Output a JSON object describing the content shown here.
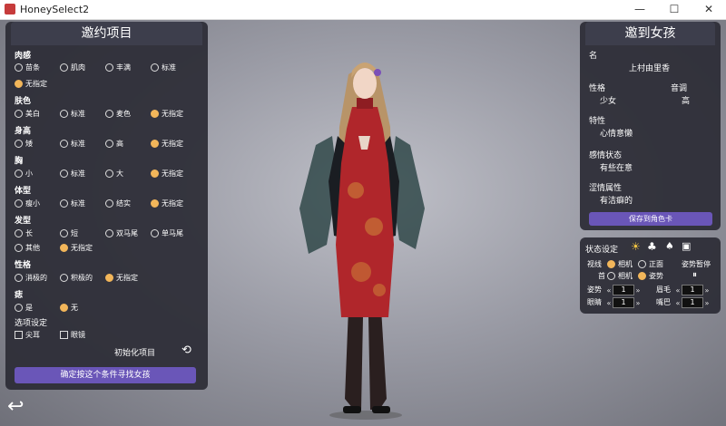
{
  "window": {
    "title": "HoneySelect2",
    "minimize": "—",
    "maximize": "☐",
    "close": "✕"
  },
  "left_panel": {
    "title": "邀约项目",
    "sections": [
      {
        "label": "肉感",
        "options": [
          {
            "label": "苗条",
            "selected": false
          },
          {
            "label": "肌肉",
            "selected": false
          },
          {
            "label": "丰满",
            "selected": false
          },
          {
            "label": "标准",
            "selected": false
          },
          {
            "label": "无指定",
            "selected": true
          }
        ]
      },
      {
        "label": "肤色",
        "options": [
          {
            "label": "美白",
            "selected": false
          },
          {
            "label": "标准",
            "selected": false
          },
          {
            "label": "麦色",
            "selected": false
          },
          {
            "label": "无指定",
            "selected": true
          }
        ]
      },
      {
        "label": "身高",
        "options": [
          {
            "label": "矮",
            "selected": false
          },
          {
            "label": "标准",
            "selected": false
          },
          {
            "label": "高",
            "selected": false
          },
          {
            "label": "无指定",
            "selected": true
          }
        ]
      },
      {
        "label": "胸",
        "options": [
          {
            "label": "小",
            "selected": false
          },
          {
            "label": "标准",
            "selected": false
          },
          {
            "label": "大",
            "selected": false
          },
          {
            "label": "无指定",
            "selected": true
          }
        ]
      },
      {
        "label": "体型",
        "options": [
          {
            "label": "瘦小",
            "selected": false
          },
          {
            "label": "标准",
            "selected": false
          },
          {
            "label": "结实",
            "selected": false
          },
          {
            "label": "无指定",
            "selected": true
          }
        ]
      },
      {
        "label": "发型",
        "options": [
          {
            "label": "长",
            "selected": false
          },
          {
            "label": "短",
            "selected": false
          },
          {
            "label": "双马尾",
            "selected": false
          },
          {
            "label": "单马尾",
            "selected": false
          },
          {
            "label": "其他",
            "selected": false
          },
          {
            "label": "无指定",
            "selected": true
          }
        ]
      },
      {
        "label": "性格",
        "options": [
          {
            "label": "消极的",
            "selected": false
          },
          {
            "label": "积极的",
            "selected": false
          },
          {
            "label": "无指定",
            "selected": true
          }
        ]
      },
      {
        "label": "痣",
        "options": [
          {
            "label": "是",
            "selected": false
          },
          {
            "label": "无",
            "selected": true
          }
        ]
      }
    ],
    "extra_label": "选项设定",
    "extras": [
      {
        "label": "尖耳",
        "checked": false
      },
      {
        "label": "眼镜",
        "checked": false
      }
    ],
    "reset_label": "初始化项目",
    "search_button": "确定按这个条件寻找女孩"
  },
  "right_panel": {
    "title": "邀到女孩",
    "name_label": "名",
    "name_value": "上村由里香",
    "personality_label": "性格",
    "personality_value": "少女",
    "voice_label": "音调",
    "voice_value": "高",
    "trait_label": "特性",
    "trait_value": "心情意懒",
    "mood_label": "感情状态",
    "mood_value": "有些在意",
    "fetish_label": "涩情属性",
    "fetish_value": "有洁癖的",
    "save_button": "保存到角色卡"
  },
  "state_panel": {
    "title": "状态设定",
    "line_label": "视线",
    "line_opt1": "相机",
    "line_opt2": "正面",
    "pose_stop_label": "姿势暂停",
    "neck_label": "首",
    "neck_opt1": "相机",
    "neck_opt2": "姿势",
    "pose_label": "姿势",
    "pose_value": "1",
    "brow_label": "眉毛",
    "brow_value": "1",
    "eye_label": "眼睛",
    "eye_value": "1",
    "mouth_label": "嘴巴",
    "mouth_value": "1"
  },
  "colors": {
    "panel": "#2c2c36",
    "accent_button": "#6a56b8",
    "selected_radio": "#f2b65a",
    "dress": "#b0262b"
  }
}
